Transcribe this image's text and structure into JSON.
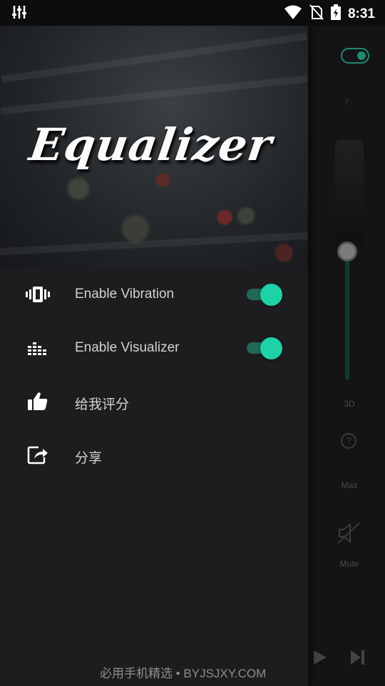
{
  "status_bar": {
    "time": "8:31",
    "icons": [
      "equalizer-notification-icon",
      "wifi-icon",
      "no-sim-icon",
      "battery-charging-icon"
    ]
  },
  "background_app": {
    "toggle_on": true,
    "scale_top": "7",
    "knob_label": "3D",
    "max_label": "Max",
    "mute_label": "Mute",
    "accent_color": "#1f8a6c"
  },
  "drawer": {
    "header_title": "Equalizer",
    "menu": [
      {
        "label": "Enable Vibration",
        "icon": "vibration-icon",
        "toggle": true
      },
      {
        "label": "Enable Visualizer",
        "icon": "visualizer-bars-icon",
        "toggle": true
      },
      {
        "label": "给我评分",
        "icon": "thumbs-up-icon"
      },
      {
        "label": "分享",
        "icon": "share-icon"
      }
    ],
    "switch_color": "#1fd1a6"
  },
  "watermark": "必用手机精选 • BYJSJXY.COM"
}
